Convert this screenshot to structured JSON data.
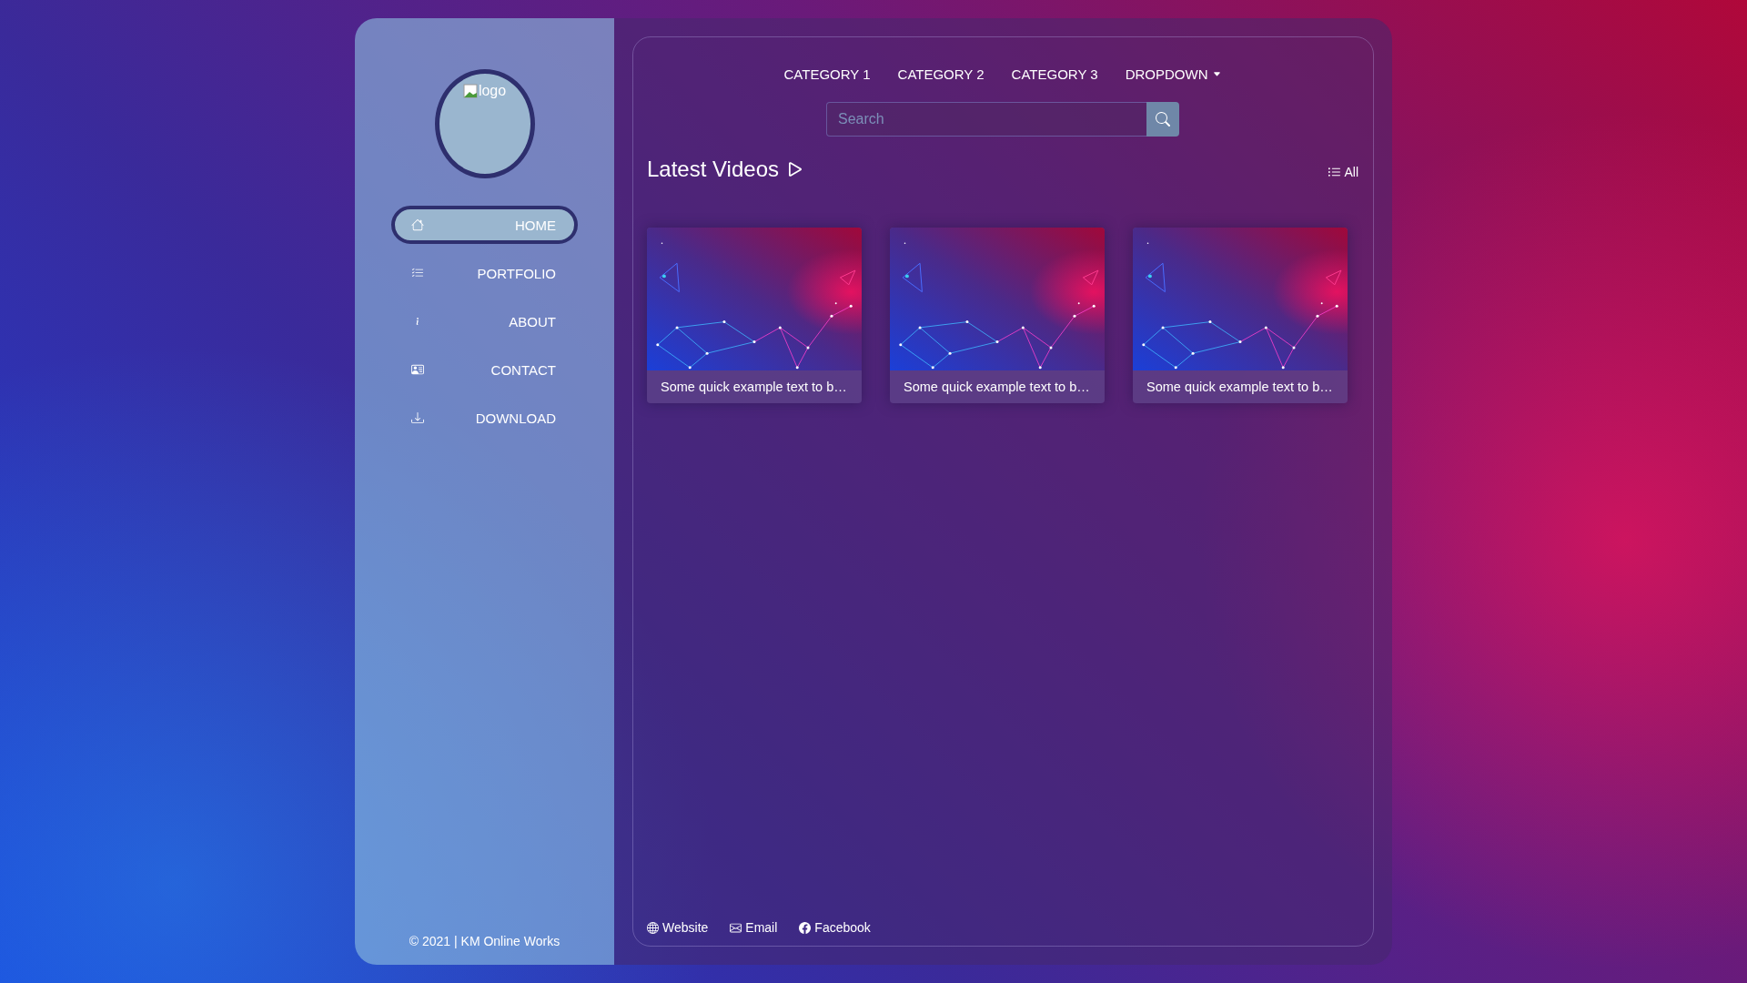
{
  "sidebar": {
    "logo": {
      "alt": "logo"
    },
    "nav": [
      {
        "label": "HOME",
        "selected": true
      },
      {
        "label": "PORTFOLIO",
        "selected": false
      },
      {
        "label": "ABOUT",
        "selected": false
      },
      {
        "label": "CONTACT",
        "selected": false
      },
      {
        "label": "DOWNLOAD",
        "selected": false
      }
    ],
    "copyright": "© 2021 | KM Online Works"
  },
  "header": {
    "categories": [
      {
        "label": "CATEGORY 1",
        "kind": "link"
      },
      {
        "label": "CATEGORY 2",
        "kind": "link"
      },
      {
        "label": "CATEGORY 3",
        "kind": "link"
      },
      {
        "label": "DROPDOWN",
        "kind": "dropdown"
      }
    ],
    "search": {
      "placeholder": "Search"
    }
  },
  "section": {
    "title": "Latest Videos",
    "all_label": "All"
  },
  "videos": [
    {
      "caption": "Some quick example text to b…"
    },
    {
      "caption": "Some quick example text to b…"
    },
    {
      "caption": "Some quick example text to b…"
    }
  ],
  "footer": {
    "links": [
      {
        "label": "Website"
      },
      {
        "label": "Email"
      },
      {
        "label": "Facebook"
      }
    ]
  }
}
